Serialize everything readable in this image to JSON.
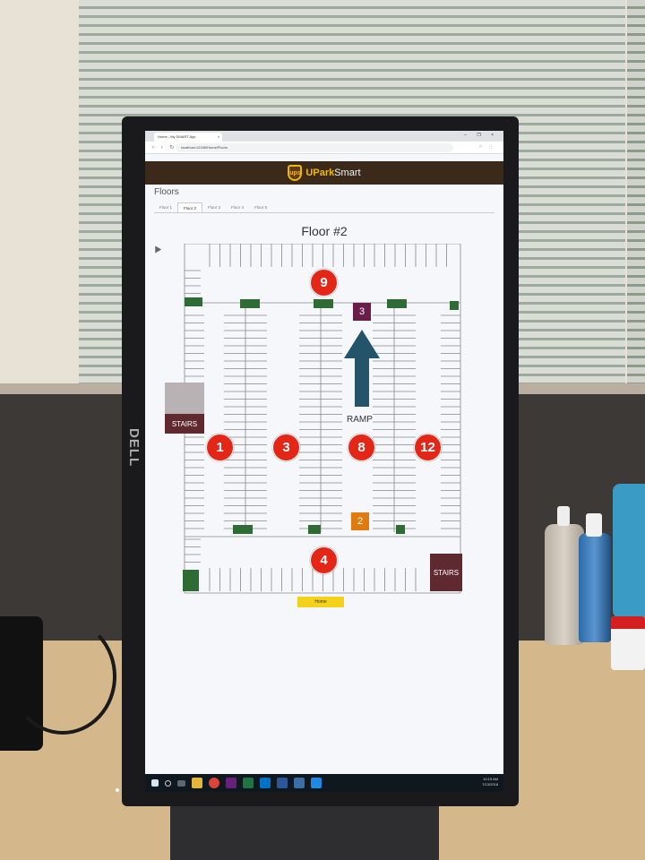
{
  "browser": {
    "tab_title": "Home - My SMART App",
    "tab_close": "×",
    "window_controls": "– ❐ ×",
    "nav_icons": "‹ › ↻",
    "url": "localhost:12345/Home/Floors",
    "extension_icons": "☆ ⋮"
  },
  "app": {
    "brand_mark": "ups",
    "brand_part1": "UPark",
    "brand_part2": "Smart",
    "page_heading": "Floors",
    "tabs": [
      "Floor 1",
      "Floor 2",
      "Floor 3",
      "Floor 4",
      "Floor 5"
    ],
    "active_tab": "Floor 2",
    "floor_title": "Floor #2",
    "home_button": "Home"
  },
  "map": {
    "sections": [
      "9",
      "1",
      "3",
      "8",
      "12",
      "4"
    ],
    "level_up": "3",
    "level_down": "2",
    "stairs_label": "STAIRS",
    "ramp_label": "RAMP"
  },
  "monitor": {
    "brand": "DELL"
  },
  "taskbar": {
    "time": "10:15 AM",
    "date": "7/13/2018"
  },
  "colors": {
    "section_marker": "#e42617",
    "level_up": "#6b1d4a",
    "level_down": "#e07b10",
    "stairs": "#5e2a2f",
    "green_spot": "#2e6b35",
    "ramp_arrow": "#24546a",
    "home_button": "#f5d21a",
    "header_bg": "#3b2a1a",
    "brand_yellow": "#f2b705"
  }
}
